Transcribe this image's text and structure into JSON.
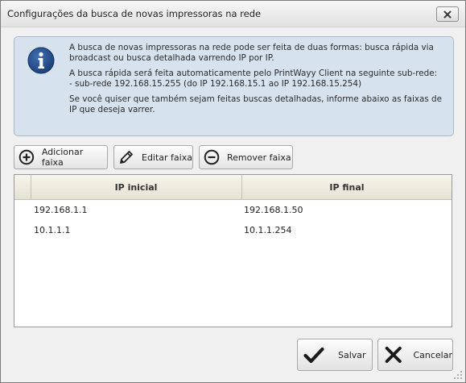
{
  "window": {
    "title": "Configurações da busca de novas impressoras na rede"
  },
  "info": {
    "paragraph1": "A busca de novas impressoras na rede pode ser feita de duas formas: busca rápida via broadcast ou busca detalhada varrendo IP por IP.",
    "paragraph2": "A busca rápida será feita automaticamente pelo PrintWayy Client na seguinte sub-rede:\n   - sub-rede 192.168.15.255 (do IP 192.168.15.1 ao IP 192.168.15.254)",
    "paragraph3": "Se você quiser que também sejam feitas buscas detalhadas, informe abaixo as faixas de IP que deseja varrer.",
    "icon": "info-icon"
  },
  "toolbar": {
    "add_label": "Adicionar faixa",
    "edit_label": "Editar faixa",
    "remove_label": "Remover faixa"
  },
  "grid": {
    "columns": [
      "IP inicial",
      "IP final"
    ],
    "rows": [
      [
        "192.168.1.1",
        "192.168.1.50"
      ],
      [
        "10.1.1.1",
        "10.1.1.254"
      ]
    ]
  },
  "actions": {
    "save_label": "Salvar",
    "cancel_label": "Cancelar"
  }
}
